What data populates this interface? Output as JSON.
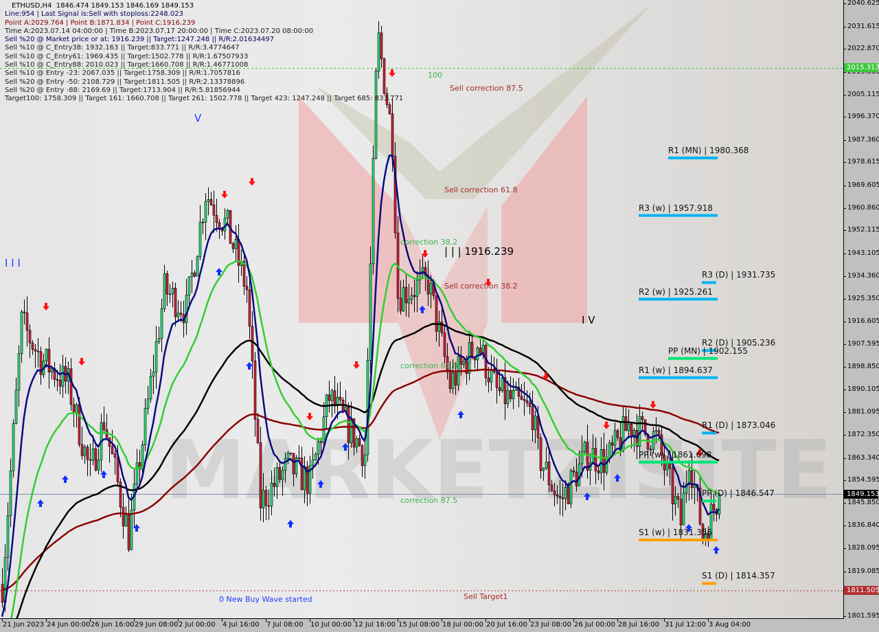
{
  "chart_data": {
    "type": "candlestick",
    "symbol": "ETHUSD,H4",
    "ohlc_header": "1846.474 1849.153 1846.169 1849.153",
    "info_lines": [
      "Line:954 | Last Signal is:Sell with stoploss:2248.023",
      "Point A:2029.764 | Point B:1871.834 | Point C:1916.239",
      "Time A:2023.07.14 04:00:00 | Time B:2023.07.17 20:00:00 | Time C:2023.07.20 08:00:00",
      "Sell %20 @ Market price or at: 1916.239 || Target:1247.248 || R/R:2.01634497",
      "Sell %10 @ C_Entry38: 1932.163 || Target:833.771 || R/R:3.4774647",
      "Sell %10 @ C_Entry61: 1969.435 || Target:1502.778 || R/R:1.67507933",
      "Sell %10 @ C_Entry88: 2010.023 || Target:1660.708 || R/R:1.46771008",
      "Sell %10 @ Entry -23: 2067.035 || Target:1758.309 || R/R:1.7057816",
      "Sell %20 @ Entry -50: 2108.729 || Target:1811.505 || R/R:2.13378896",
      "Sell %20 @ Entry -88: 2169.69 || Target:1713.904 || R/R:5.81856944",
      "Target100: 1758.309 || Target 161: 1660.708 || Target 261: 1502.778 || Target 423: 1247.248 || Target 685: 833.771"
    ],
    "ylim": [
      1801.595,
      2040.625
    ],
    "y_ticks": [
      "2040.625",
      "2031.615",
      "2022.870",
      "2013.860",
      "2005.115",
      "1996.370",
      "1987.360",
      "1978.615",
      "1969.605",
      "1960.860",
      "1952.115",
      "1943.105",
      "1934.360",
      "1925.350",
      "1916.605",
      "1907.595",
      "1898.850",
      "1890.105",
      "1881.095",
      "1872.350",
      "1863.340",
      "1854.595",
      "1845.850",
      "1836.840",
      "1828.095",
      "1819.085",
      "1810.340",
      "1801.595"
    ],
    "x_start": "2023-06-21T08:00",
    "x_ticks": [
      {
        "label": "21 Jun 2023",
        "t": "2023-06-21T08:00"
      },
      {
        "label": "24 Jun 00:00",
        "t": "2023-06-24T00:00"
      },
      {
        "label": "26 Jun 16:00",
        "t": "2023-06-26T16:00"
      },
      {
        "label": "29 Jun 08:00",
        "t": "2023-06-29T08:00"
      },
      {
        "label": "2 Jul 00:00",
        "t": "2023-07-02T00:00"
      },
      {
        "label": "4 Jul 16:00",
        "t": "2023-07-04T16:00"
      },
      {
        "label": "7 Jul 08:00",
        "t": "2023-07-07T08:00"
      },
      {
        "label": "10 Jul 00:00",
        "t": "2023-07-10T00:00"
      },
      {
        "label": "12 Jul 16:00",
        "t": "2023-07-12T16:00"
      },
      {
        "label": "15 Jul 08:00",
        "t": "2023-07-15T08:00"
      },
      {
        "label": "18 Jul 00:00",
        "t": "2023-07-18T00:00"
      },
      {
        "label": "20 Jul 16:00",
        "t": "2023-07-20T16:00"
      },
      {
        "label": "23 Jul 08:00",
        "t": "2023-07-23T08:00"
      },
      {
        "label": "26 Jul 00:00",
        "t": "2023-07-26T00:00"
      },
      {
        "label": "28 Jul 16:00",
        "t": "2023-07-28T16:00"
      },
      {
        "label": "31 Jul 12:00",
        "t": "2023-07-31T12:00"
      },
      {
        "label": "3 Aug 04:00",
        "t": "2023-08-03T04:00"
      }
    ],
    "price_path": [
      [
        "2023-06-21T08:00",
        1814
      ],
      [
        "2023-06-22T12:00",
        1916
      ],
      [
        "2023-06-23T16:00",
        1902
      ],
      [
        "2023-06-25T08:00",
        1892
      ],
      [
        "2023-06-26T16:00",
        1857
      ],
      [
        "2023-06-27T12:00",
        1878
      ],
      [
        "2023-06-29T00:00",
        1833
      ],
      [
        "2023-06-30T08:00",
        1892
      ],
      [
        "2023-07-01T04:00",
        1929
      ],
      [
        "2023-07-02T12:00",
        1921
      ],
      [
        "2023-07-03T16:00",
        1967
      ],
      [
        "2023-07-05T00:00",
        1953
      ],
      [
        "2023-07-06T04:00",
        1929
      ],
      [
        "2023-07-07T00:00",
        1846
      ],
      [
        "2023-07-08T16:00",
        1860
      ],
      [
        "2023-07-10T00:00",
        1854
      ],
      [
        "2023-07-11T04:00",
        1887
      ],
      [
        "2023-07-13T08:00",
        1865
      ],
      [
        "2023-07-14T00:00",
        2010
      ],
      [
        "2023-07-14T04:00",
        2026
      ],
      [
        "2023-07-15T00:00",
        1988
      ],
      [
        "2023-07-15T08:00",
        1927
      ],
      [
        "2023-07-17T04:00",
        1932
      ],
      [
        "2023-07-18T12:00",
        1892
      ],
      [
        "2023-07-20T04:00",
        1908
      ],
      [
        "2023-07-21T08:00",
        1889
      ],
      [
        "2023-07-23T12:00",
        1881
      ],
      [
        "2023-07-23T20:00",
        1865
      ],
      [
        "2023-07-25T04:00",
        1846
      ],
      [
        "2023-07-26T20:00",
        1865
      ],
      [
        "2023-07-28T00:00",
        1862
      ],
      [
        "2023-07-29T08:00",
        1876
      ],
      [
        "2023-07-31T00:00",
        1871
      ],
      [
        "2023-08-01T12:00",
        1838
      ],
      [
        "2023-08-02T00:00",
        1865
      ],
      [
        "2023-08-02T20:00",
        1833
      ],
      [
        "2023-08-03T20:00",
        1849.153
      ]
    ],
    "sell_signals": [
      [
        "2023-06-24T00:00",
        1922.2
      ],
      [
        "2023-06-26T04:00",
        1900.7
      ],
      [
        "2023-07-04T20:00",
        1965.9
      ],
      [
        "2023-07-06T12:00",
        1970.9
      ],
      [
        "2023-07-10T00:00",
        1879.3
      ],
      [
        "2023-07-12T20:00",
        1899.4
      ],
      [
        "2023-07-15T00:00",
        2013.3
      ],
      [
        "2023-07-17T00:00",
        1942.8
      ],
      [
        "2023-07-20T20:00",
        1931.6
      ],
      [
        "2023-07-24T08:00",
        1895.1
      ],
      [
        "2023-07-28T00:00",
        1875.9
      ],
      [
        "2023-07-30T20:00",
        1883.9
      ],
      [
        "2023-08-02T16:00",
        1865.1
      ]
    ],
    "buy_signals": [
      [
        "2023-06-23T16:00",
        1845.8
      ],
      [
        "2023-06-25T04:00",
        1855.2
      ],
      [
        "2023-06-27T12:00",
        1857.1
      ],
      [
        "2023-06-29T12:00",
        1836.2
      ],
      [
        "2023-07-04T12:00",
        1936.1
      ],
      [
        "2023-07-06T08:00",
        1899.4
      ],
      [
        "2023-07-08T20:00",
        1837.8
      ],
      [
        "2023-07-10T16:00",
        1853.3
      ],
      [
        "2023-07-12T04:00",
        1867.8
      ],
      [
        "2023-07-16T20:00",
        1921.4
      ],
      [
        "2023-07-19T04:00",
        1880.4
      ],
      [
        "2023-07-26T20:00",
        1848.5
      ],
      [
        "2023-07-28T16:00",
        1855.7
      ],
      [
        "2023-08-02T00:00",
        1836.2
      ],
      [
        "2023-08-03T16:00",
        1827.6
      ]
    ],
    "pivots": [
      {
        "label": "R1 (MN) | 1980.368",
        "price": 1980.368,
        "color": "#00b4f0",
        "span": "monthly"
      },
      {
        "label": "R3 (w) | 1957.918",
        "price": 1957.918,
        "color": "#00b4f0",
        "span": "weekly"
      },
      {
        "label": "R3 (D) | 1931.735",
        "price": 1931.735,
        "color": "#00b4f0",
        "span": "daily"
      },
      {
        "label": "R2 (w) | 1925.261",
        "price": 1925.261,
        "color": "#00b4f0",
        "span": "weekly"
      },
      {
        "label": "R2 (D) | 1905.236",
        "price": 1905.236,
        "color": "#00b4f0",
        "span": "daily"
      },
      {
        "label": "PP (MN) | 1902.155",
        "price": 1902.155,
        "color": "#00e676",
        "span": "monthly"
      },
      {
        "label": "R1 (w) | 1894.637",
        "price": 1894.637,
        "color": "#00b4f0",
        "span": "weekly"
      },
      {
        "label": "R1 (D) | 1873.046",
        "price": 1873.046,
        "color": "#00b4f0",
        "span": "daily"
      },
      {
        "label": "PP (w) | 1861.698",
        "price": 1861.698,
        "color": "#00e676",
        "span": "weekly"
      },
      {
        "label": "PP (D) | 1846.547",
        "price": 1846.547,
        "color": "#00e676",
        "span": "daily"
      },
      {
        "label": "S1 (w) | 1831.356",
        "price": 1831.356,
        "color": "#ffa000",
        "span": "weekly"
      },
      {
        "label": "S1 (D) | 1814.357",
        "price": 1814.357,
        "color": "#ffa000",
        "span": "daily"
      }
    ],
    "annotations": [
      {
        "text": "100",
        "price": 2012.5,
        "t": "2023-07-17T04:00",
        "color": "#3cb44b"
      },
      {
        "text": "Sell correction 87.5",
        "price": 2007.5,
        "t": "2023-07-18T12:00",
        "color": "#a52a2a"
      },
      {
        "text": "Sell correction 61.8",
        "price": 1967.8,
        "t": "2023-07-18T04:00",
        "color": "#a52a2a"
      },
      {
        "text": "correction 38.2",
        "price": 1947.5,
        "t": "2023-07-15T12:00",
        "color": "#3cb44b"
      },
      {
        "text": "| | | 1916.239",
        "price": 1944.5,
        "t": "2023-07-18T04:00",
        "color": "#000000",
        "big": true
      },
      {
        "text": "Sell correction 38.2",
        "price": 1930.3,
        "t": "2023-07-18T04:00",
        "color": "#a52a2a"
      },
      {
        "text": "I V",
        "price": 1917.5,
        "t": "2023-07-26T12:00",
        "color": "#000000",
        "big": true
      },
      {
        "text": "correction 61.8",
        "price": 1899.1,
        "t": "2023-07-15T12:00",
        "color": "#3cb44b"
      },
      {
        "text": "correction 87.5",
        "price": 1846.6,
        "t": "2023-07-15T12:00",
        "color": "#3cb44b"
      },
      {
        "text": "0 New Buy Wave started",
        "price": 1808.0,
        "t": "2023-07-04T12:00",
        "color": "#1e3cff"
      },
      {
        "text": "Sell Target1",
        "price": 1809.0,
        "t": "2023-07-19T08:00",
        "color": "#a52a2a"
      },
      {
        "text": "V",
        "price": 1996.5,
        "t": "2023-07-03T00:00",
        "color": "#1e3cff",
        "big": true
      },
      {
        "text": "I I I",
        "price": 1940.0,
        "t": "2023-06-21T12:00",
        "color": "#1e3cff",
        "big": true
      }
    ],
    "levels": {
      "target_line": {
        "price": 2015.313,
        "label": "2015.313",
        "color": "#3cc83c"
      },
      "sell_target_line": {
        "price": 1811.505,
        "label": "1811.505",
        "color": "#b03030"
      },
      "bid_line": {
        "price": 1849.153,
        "label": "1849.153",
        "color": "#000000"
      }
    },
    "colors": {
      "bull": "#2ee07a",
      "bear": "#d0203a",
      "ma_fast": "#0a0a80",
      "ma_mid": "#32cd32",
      "ma_slow": "#000000",
      "ma_long": "#8b0000"
    }
  }
}
